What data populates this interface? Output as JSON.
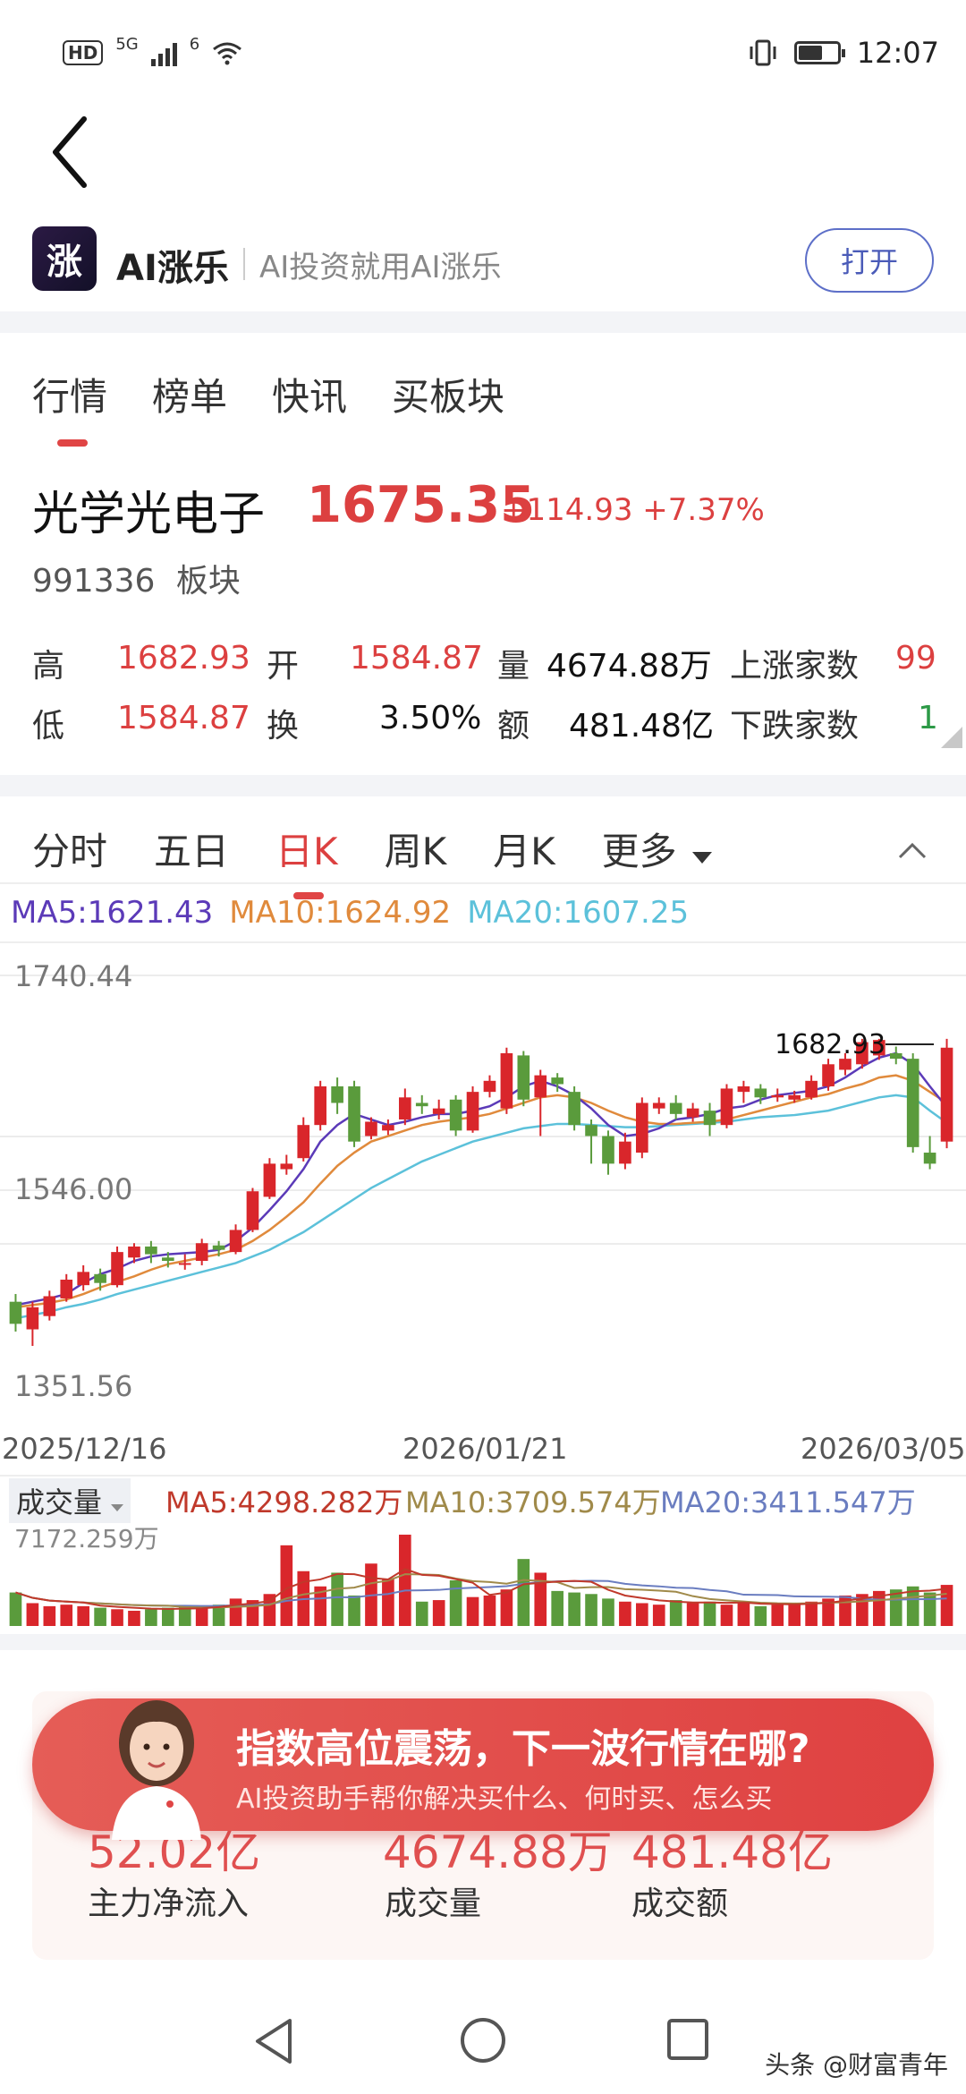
{
  "status_bar": {
    "hd": "HD",
    "net1": "5G",
    "net2": "6",
    "time": "12:07",
    "battery_level": 0.6
  },
  "app_banner": {
    "logo_text": "涨",
    "name": "AI涨乐",
    "slogan": "AI投资就用AI涨乐",
    "open_label": "打开"
  },
  "main_tabs": [
    {
      "label": "行情",
      "active": true
    },
    {
      "label": "榜单"
    },
    {
      "label": "快讯"
    },
    {
      "label": "买板块"
    }
  ],
  "quote": {
    "name": "光学光电子",
    "price": "1675.35",
    "change": "+114.93 +7.37%",
    "code": "991336",
    "type": "板块"
  },
  "stats": {
    "high_label": "高",
    "high": "1682.93",
    "open_label": "开",
    "open": "1584.87",
    "volume_label": "量",
    "volume": "4674.88万",
    "up_label": "上涨家数",
    "up_count": "99",
    "low_label": "低",
    "low": "1584.87",
    "turnover_label": "换",
    "turnover": "3.50%",
    "amount_label": "额",
    "amount": "481.48亿",
    "down_label": "下跌家数",
    "down_count": "1"
  },
  "chart_tabs": [
    {
      "label": "分时"
    },
    {
      "label": "五日"
    },
    {
      "label": "日K",
      "active": true
    },
    {
      "label": "周K"
    },
    {
      "label": "月K"
    },
    {
      "label": "更多"
    }
  ],
  "ma_legend": {
    "ma5": "MA5:1621.43",
    "ma10": "MA10:1624.92",
    "ma20": "MA20:1607.25"
  },
  "colors": {
    "up": "#d9262b",
    "down": "#5a9b3c",
    "ma5": "#5b3ab8",
    "ma10": "#e08a3c",
    "ma20": "#5cc1da",
    "accent": "#e04545"
  },
  "vol_header": {
    "select_label": "成交量",
    "ma5": "MA5:4298.282万",
    "ma10": "MA10:3709.574万",
    "ma20": "MA20:3411.547万",
    "max_label": "7172.259万"
  },
  "chart_data": {
    "type": "candlestick",
    "y_axis_labels": [
      "1740.44",
      "1546.00",
      "1351.56"
    ],
    "ylim": [
      1351.56,
      1740.44
    ],
    "x_axis_labels": [
      "2025/12/16",
      "2026/01/21",
      "2026/03/05"
    ],
    "max_annotation": "1682.93",
    "candles": [
      {
        "o": 1445,
        "c": 1425,
        "h": 1452,
        "l": 1418
      },
      {
        "o": 1420,
        "c": 1440,
        "h": 1445,
        "l": 1405
      },
      {
        "o": 1432,
        "c": 1450,
        "h": 1455,
        "l": 1428
      },
      {
        "o": 1448,
        "c": 1465,
        "h": 1470,
        "l": 1445
      },
      {
        "o": 1460,
        "c": 1472,
        "h": 1478,
        "l": 1455
      },
      {
        "o": 1470,
        "c": 1462,
        "h": 1475,
        "l": 1455
      },
      {
        "o": 1460,
        "c": 1490,
        "h": 1495,
        "l": 1458
      },
      {
        "o": 1485,
        "c": 1495,
        "h": 1498,
        "l": 1480
      },
      {
        "o": 1495,
        "c": 1488,
        "h": 1500,
        "l": 1480
      },
      {
        "o": 1485,
        "c": 1482,
        "h": 1490,
        "l": 1476
      },
      {
        "o": 1480,
        "c": 1480,
        "h": 1488,
        "l": 1474
      },
      {
        "o": 1482,
        "c": 1498,
        "h": 1502,
        "l": 1478
      },
      {
        "o": 1496,
        "c": 1492,
        "h": 1500,
        "l": 1486
      },
      {
        "o": 1490,
        "c": 1510,
        "h": 1515,
        "l": 1488
      },
      {
        "o": 1510,
        "c": 1545,
        "h": 1548,
        "l": 1508
      },
      {
        "o": 1540,
        "c": 1570,
        "h": 1575,
        "l": 1538
      },
      {
        "o": 1565,
        "c": 1570,
        "h": 1578,
        "l": 1560
      },
      {
        "o": 1575,
        "c": 1605,
        "h": 1612,
        "l": 1572
      },
      {
        "o": 1605,
        "c": 1640,
        "h": 1645,
        "l": 1600
      },
      {
        "o": 1640,
        "c": 1625,
        "h": 1648,
        "l": 1615
      },
      {
        "o": 1640,
        "c": 1590,
        "h": 1645,
        "l": 1585
      },
      {
        "o": 1595,
        "c": 1608,
        "h": 1612,
        "l": 1592
      },
      {
        "o": 1600,
        "c": 1605,
        "h": 1610,
        "l": 1596
      },
      {
        "o": 1610,
        "c": 1630,
        "h": 1638,
        "l": 1605
      },
      {
        "o": 1625,
        "c": 1622,
        "h": 1632,
        "l": 1615
      },
      {
        "o": 1615,
        "c": 1620,
        "h": 1628,
        "l": 1610
      },
      {
        "o": 1628,
        "c": 1600,
        "h": 1632,
        "l": 1595
      },
      {
        "o": 1600,
        "c": 1635,
        "h": 1640,
        "l": 1598
      },
      {
        "o": 1635,
        "c": 1645,
        "h": 1650,
        "l": 1630
      },
      {
        "o": 1620,
        "c": 1670,
        "h": 1675,
        "l": 1615
      },
      {
        "o": 1668,
        "c": 1628,
        "h": 1672,
        "l": 1622
      },
      {
        "o": 1630,
        "c": 1650,
        "h": 1655,
        "l": 1595
      },
      {
        "o": 1648,
        "c": 1642,
        "h": 1652,
        "l": 1635
      },
      {
        "o": 1635,
        "c": 1605,
        "h": 1640,
        "l": 1600
      },
      {
        "o": 1605,
        "c": 1595,
        "h": 1610,
        "l": 1570
      },
      {
        "o": 1595,
        "c": 1570,
        "h": 1600,
        "l": 1560
      },
      {
        "o": 1570,
        "c": 1590,
        "h": 1598,
        "l": 1565
      },
      {
        "o": 1580,
        "c": 1625,
        "h": 1630,
        "l": 1575
      },
      {
        "o": 1620,
        "c": 1625,
        "h": 1630,
        "l": 1615
      },
      {
        "o": 1625,
        "c": 1615,
        "h": 1632,
        "l": 1610
      },
      {
        "o": 1612,
        "c": 1620,
        "h": 1625,
        "l": 1608
      },
      {
        "o": 1618,
        "c": 1605,
        "h": 1625,
        "l": 1595
      },
      {
        "o": 1605,
        "c": 1638,
        "h": 1642,
        "l": 1602
      },
      {
        "o": 1635,
        "c": 1640,
        "h": 1645,
        "l": 1625
      },
      {
        "o": 1638,
        "c": 1630,
        "h": 1642,
        "l": 1624
      },
      {
        "o": 1630,
        "c": 1632,
        "h": 1638,
        "l": 1626
      },
      {
        "o": 1628,
        "c": 1632,
        "h": 1636,
        "l": 1625
      },
      {
        "o": 1630,
        "c": 1645,
        "h": 1650,
        "l": 1628
      },
      {
        "o": 1640,
        "c": 1660,
        "h": 1665,
        "l": 1636
      },
      {
        "o": 1655,
        "c": 1665,
        "h": 1670,
        "l": 1650
      },
      {
        "o": 1660,
        "c": 1680,
        "h": 1683,
        "l": 1656
      },
      {
        "o": 1668,
        "c": 1682,
        "h": 1683,
        "l": 1664
      },
      {
        "o": 1670,
        "c": 1665,
        "h": 1676,
        "l": 1660
      },
      {
        "o": 1665,
        "c": 1585,
        "h": 1670,
        "l": 1580
      },
      {
        "o": 1580,
        "c": 1570,
        "h": 1595,
        "l": 1565
      },
      {
        "o": 1590,
        "c": 1675,
        "h": 1683,
        "l": 1584
      }
    ],
    "ma5": [
      1442,
      1445,
      1448,
      1452,
      1462,
      1470,
      1475,
      1482,
      1486,
      1488,
      1489,
      1490,
      1492,
      1500,
      1512,
      1528,
      1545,
      1565,
      1590,
      1605,
      1615,
      1610,
      1605,
      1608,
      1612,
      1615,
      1615,
      1618,
      1622,
      1630,
      1640,
      1645,
      1640,
      1632,
      1620,
      1605,
      1595,
      1597,
      1602,
      1610,
      1612,
      1615,
      1620,
      1622,
      1628,
      1632,
      1634,
      1636,
      1640,
      1648,
      1658,
      1666,
      1670,
      1660,
      1640,
      1621
    ],
    "ma10": [
      1440,
      1442,
      1444,
      1447,
      1452,
      1458,
      1463,
      1468,
      1474,
      1479,
      1482,
      1485,
      1488,
      1492,
      1500,
      1510,
      1522,
      1535,
      1552,
      1568,
      1580,
      1590,
      1595,
      1600,
      1605,
      1608,
      1610,
      1612,
      1615,
      1620,
      1625,
      1630,
      1632,
      1630,
      1625,
      1618,
      1612,
      1608,
      1606,
      1606,
      1607,
      1608,
      1610,
      1614,
      1618,
      1622,
      1626,
      1630,
      1633,
      1638,
      1642,
      1648,
      1650,
      1645,
      1635,
      1625
    ],
    "ma20": [
      1430,
      1433,
      1436,
      1440,
      1443,
      1447,
      1452,
      1456,
      1460,
      1464,
      1468,
      1472,
      1476,
      1480,
      1486,
      1492,
      1500,
      1508,
      1518,
      1528,
      1538,
      1548,
      1556,
      1564,
      1572,
      1578,
      1584,
      1590,
      1594,
      1598,
      1602,
      1604,
      1606,
      1606,
      1605,
      1604,
      1603,
      1603,
      1604,
      1605,
      1606,
      1607,
      1608,
      1610,
      1612,
      1613,
      1614,
      1616,
      1618,
      1622,
      1626,
      1630,
      1632,
      1630,
      1618,
      1607
    ],
    "volume": {
      "unit": "万",
      "values": [
        2200,
        1500,
        1300,
        1400,
        1300,
        1200,
        1100,
        1000,
        1100,
        1200,
        1300,
        1200,
        1400,
        1800,
        1700,
        2100,
        2200,
        2500,
        2600,
        2600,
        2000,
        1500,
        1600,
        1400,
        1600,
        1700,
        1600,
        1900,
        2000,
        2400,
        3000,
        2100,
        2300,
        2200,
        2100,
        1800,
        1600,
        1500,
        1400,
        1700,
        1500,
        1600,
        1400,
        1500,
        1300,
        1400,
        1500,
        1600,
        1800,
        2000,
        2100,
        2300,
        2400,
        2600,
        2200,
        2700
      ],
      "max": 7172.259,
      "highlights": [
        {
          "i": 16,
          "v": 5300
        },
        {
          "i": 17,
          "v": 3600
        },
        {
          "i": 19,
          "v": 3500
        },
        {
          "i": 21,
          "v": 4100
        },
        {
          "i": 22,
          "v": 3100
        },
        {
          "i": 23,
          "v": 6000
        },
        {
          "i": 26,
          "v": 3000
        },
        {
          "i": 30,
          "v": 4400
        },
        {
          "i": 31,
          "v": 3500
        }
      ],
      "colors_up": [
        false,
        true,
        true,
        true,
        true,
        false,
        true,
        true,
        false,
        false,
        false,
        true,
        false,
        true,
        true,
        true,
        true,
        true,
        true,
        false,
        false,
        true,
        true,
        true,
        false,
        true,
        false,
        true,
        true,
        true,
        false,
        true,
        false,
        false,
        false,
        false,
        true,
        true,
        true,
        false,
        true,
        false,
        true,
        true,
        false,
        true,
        true,
        true,
        true,
        true,
        true,
        true,
        false,
        false,
        false,
        true
      ]
    }
  },
  "fund_card": {
    "title": "主力净流入",
    "inflow": "52.02亿",
    "inflow_label": "主力净流入",
    "volume": "4674.88万",
    "volume_label": "成交量",
    "amount": "481.48亿",
    "amount_label": "成交额"
  },
  "ad": {
    "title": "指数高位震荡，下一波行情在哪?",
    "subtitle": "AI投资助手帮你解决买什么、何时买、怎么买"
  },
  "watermark": "头条 @财富青年"
}
